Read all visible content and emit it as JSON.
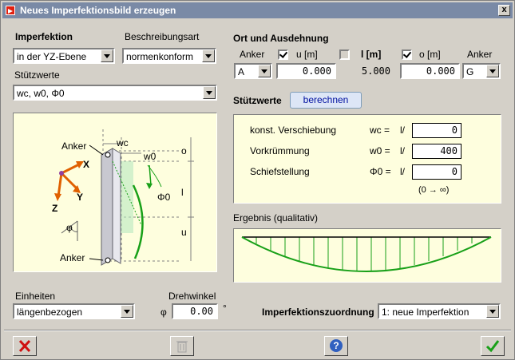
{
  "window": {
    "title": "Neues Imperfektionsbild erzeugen",
    "close": "x"
  },
  "left": {
    "imperfektion_label": "Imperfektion",
    "imperfektion_value": "in der YZ-Ebene",
    "beschreibung_label": "Beschreibungsart",
    "beschreibung_value": "normenkonform",
    "stuetzwerte_label": "Stützwerte",
    "stuetzwerte_value": "wc, w0, Φ0",
    "diagram": {
      "anker_top": "Anker",
      "anker_bottom": "Anker",
      "wc": "wc",
      "w0": "w0",
      "phi0": "Φ0",
      "o": "o",
      "l": "l",
      "u": "u",
      "x": "X",
      "y": "Y",
      "z": "Z",
      "phi": "φ"
    },
    "einheiten_label": "Einheiten",
    "einheiten_value": "längenbezogen",
    "drehwinkel_label": "Drehwinkel",
    "drehwinkel_symbol": "φ",
    "drehwinkel_value": "0.00",
    "drehwinkel_unit": "°"
  },
  "ort": {
    "title": "Ort und Ausdehnung",
    "anker_label": "Anker",
    "anker_left_value": "A",
    "u_label": "u [m]",
    "u_value": "0.000",
    "l_label": "l [m]",
    "l_value": "5.000",
    "o_label": "o [m]",
    "o_value": "0.000",
    "anker_right_label": "Anker",
    "anker_right_value": "G"
  },
  "stuetzwerte": {
    "title": "Stützwerte",
    "berechnen": "berechnen",
    "rows": [
      {
        "label": "konst. Verschiebung",
        "symbol": "wc =",
        "div": "l/",
        "value": "0"
      },
      {
        "label": "Vorkrümmung",
        "symbol": "w0 =",
        "div": "l/",
        "value": "400"
      },
      {
        "label": "Schiefstellung",
        "symbol": "Φ0 =",
        "div": "l/",
        "value": "0"
      }
    ],
    "hint": "(0 → ∞)"
  },
  "ergebnis": {
    "title": "Ergebnis (qualitativ)"
  },
  "zuordnung": {
    "label": "Imperfektionszuordnung",
    "value": "1: neue Imperfektion"
  },
  "colors": {
    "accent_green": "#18a018",
    "panel_bg": "#fefede",
    "titlebar": "#7a8aa6"
  }
}
